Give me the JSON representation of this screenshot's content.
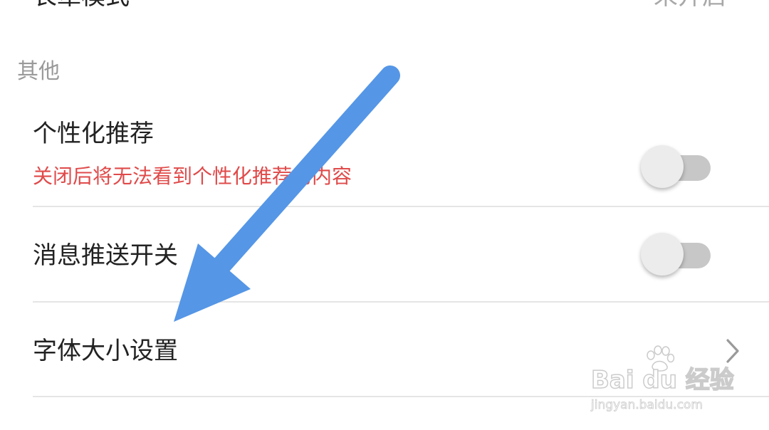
{
  "top_item": {
    "label": "长辈模式",
    "value": "未开启"
  },
  "section": {
    "title": "其他"
  },
  "items": [
    {
      "title": "个性化推荐",
      "subtitle": "关闭后将无法看到个性化推荐的内容",
      "control": "toggle",
      "state": "off"
    },
    {
      "title": "消息推送开关",
      "control": "toggle",
      "state": "off"
    },
    {
      "title": "字体大小设置",
      "control": "chevron"
    }
  ],
  "annotation": {
    "arrow_color": "#5596e6"
  },
  "watermark": {
    "logo": "Bai du 经验",
    "url": "jingyan.baidu.com"
  },
  "colors": {
    "subtitle_red": "#e04a4a",
    "section_gray": "#9a9a9a",
    "toggle_track": "#c7c7c7",
    "toggle_knob": "#ececec"
  }
}
